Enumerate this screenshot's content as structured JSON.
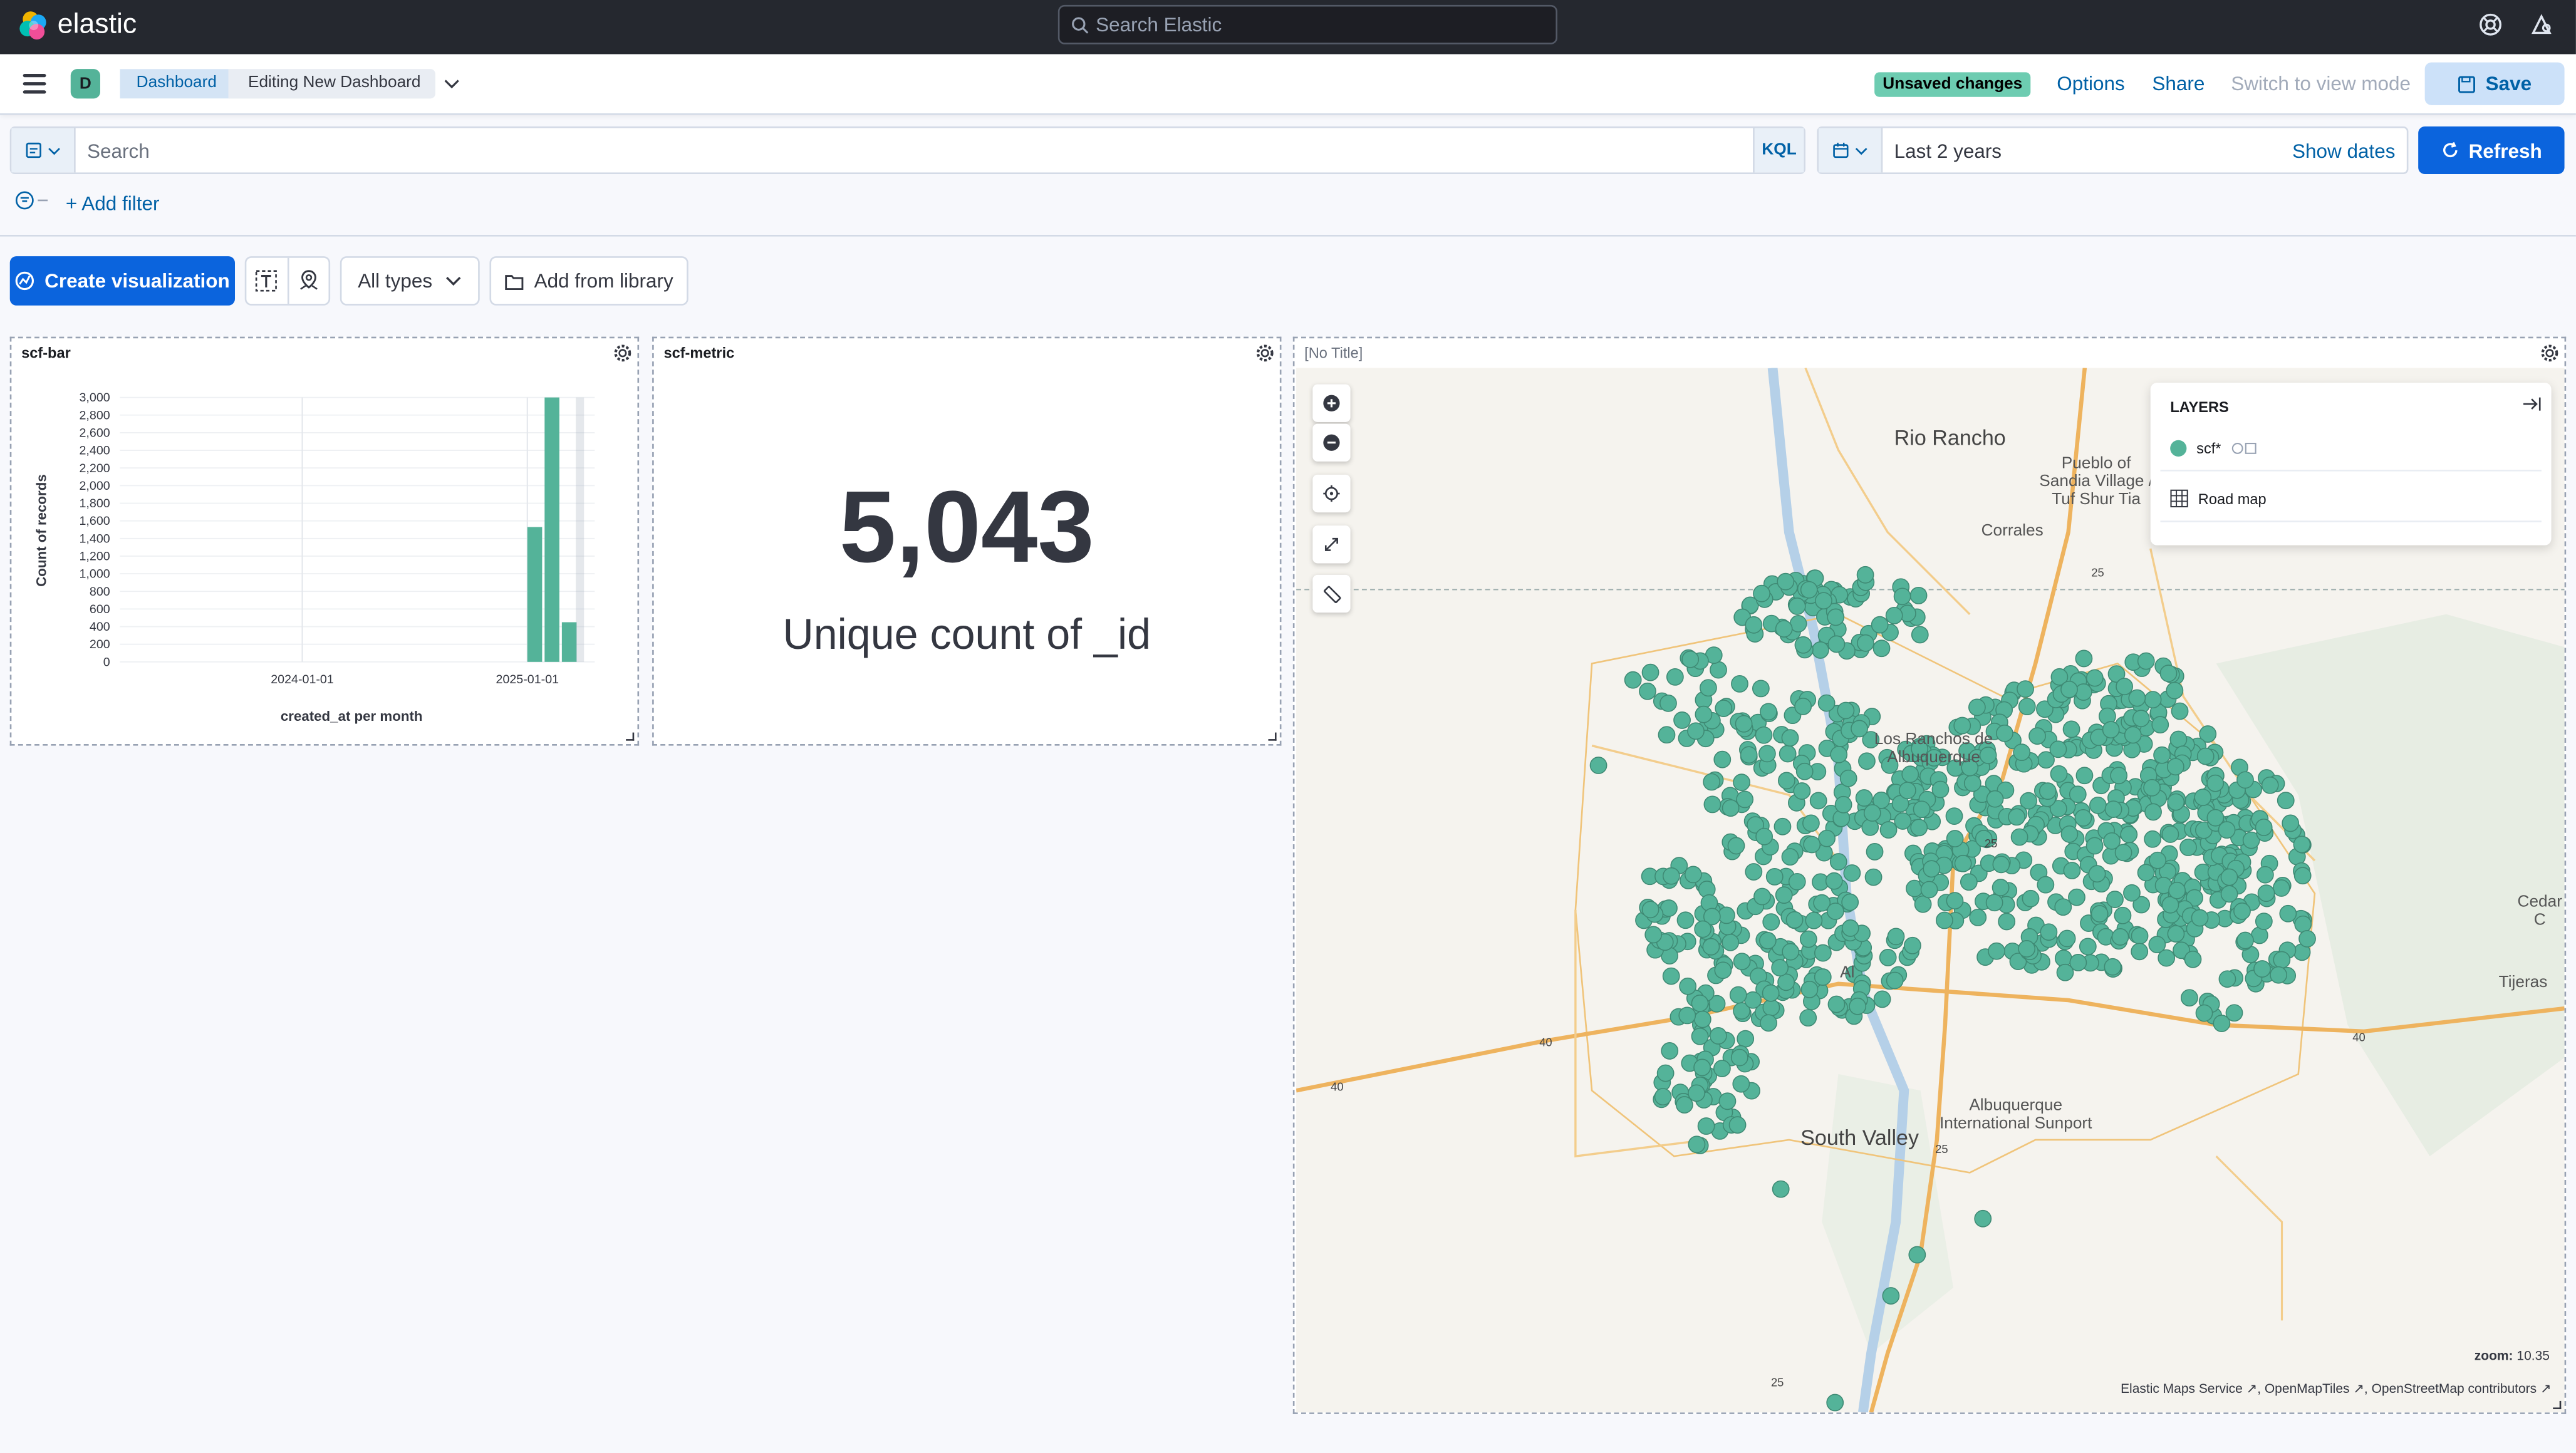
{
  "header": {
    "brand": "elastic",
    "search_placeholder": "Search Elastic"
  },
  "nav": {
    "space_initial": "D",
    "breadcrumbs": [
      "Dashboard",
      "Editing New Dashboard"
    ],
    "unsaved_badge": "Unsaved changes",
    "options": "Options",
    "share": "Share",
    "switch_view": "Switch to view mode",
    "save": "Save"
  },
  "query": {
    "placeholder": "Search",
    "language": "KQL",
    "time_range": "Last 2 years",
    "show_dates": "Show dates",
    "refresh": "Refresh",
    "add_filter": "+ Add filter"
  },
  "toolbar": {
    "create": "Create visualization",
    "types": "All types",
    "library": "Add from library"
  },
  "panels": {
    "bar": {
      "title": "scf-bar"
    },
    "metric": {
      "title": "scf-metric",
      "value": "5,043",
      "label": "Unique count of _id"
    },
    "map": {
      "title": "[No Title]",
      "layers_title": "LAYERS",
      "layers": [
        {
          "name": "scf*",
          "color": "#54b399"
        },
        {
          "name": "Road map",
          "icon": "grid-icon"
        }
      ],
      "zoom_label": "zoom:",
      "zoom_value": "10.35",
      "attribution": [
        "Elastic Maps Service",
        "OpenMapTiles",
        "OpenStreetMap contributors"
      ],
      "places": [
        "Rio Rancho",
        "Pueblo of Sandia Village / Tuf Shur Tia",
        "Corrales",
        "Los Ranchos de Albuquerque",
        "South Valley",
        "Albuquerque International Sunport",
        "Cedar C",
        "Tijeras",
        "Al"
      ],
      "highways": [
        "25",
        "40",
        "40",
        "40",
        "25",
        "25",
        "25"
      ]
    }
  },
  "chart_data": {
    "type": "bar",
    "title": "scf-bar",
    "xlabel": "created_at per month",
    "ylabel": "Count of records",
    "ylim": [
      0,
      3000
    ],
    "y_ticks": [
      "3,000",
      "2,800",
      "2,600",
      "2,400",
      "2,200",
      "2,000",
      "1,800",
      "1,600",
      "1,400",
      "1,200",
      "1,000",
      "800",
      "600",
      "400",
      "200",
      "0"
    ],
    "x_ticks": [
      "2024-01-01",
      "2025-01-01"
    ],
    "categories": [
      "2025-01",
      "2025-02",
      "2025-03"
    ],
    "values": [
      1530,
      3000,
      450
    ],
    "color": "#54b399"
  }
}
